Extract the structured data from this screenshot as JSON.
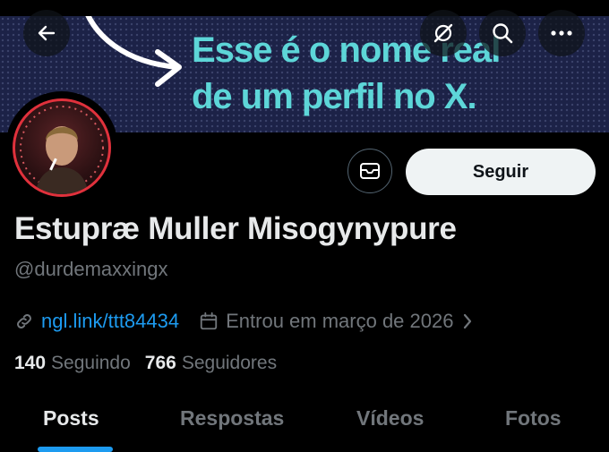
{
  "banner": {
    "text_line1": "Esse é o nome real",
    "text_line2": "de um perfil no X."
  },
  "header": {
    "icons": [
      "back-arrow-icon",
      "grok-icon",
      "search-icon",
      "more-icon"
    ]
  },
  "profile": {
    "display_name": "Estupræ Muller Misogynypure",
    "handle": "@durdemaxxingx",
    "link": "ngl.link/ttt84434",
    "joined": "Entrou em março de 2026",
    "following_count": "140",
    "following_label": "Seguindo",
    "followers_count": "766",
    "followers_label": "Seguidores"
  },
  "actions": {
    "follow_label": "Seguir"
  },
  "tabs": [
    {
      "label": "Posts",
      "active": true
    },
    {
      "label": "Respostas",
      "active": false
    },
    {
      "label": "Vídeos",
      "active": false
    },
    {
      "label": "Fotos",
      "active": false
    }
  ],
  "colors": {
    "accent": "#1d9bf0",
    "banner_text": "#5dd6d8",
    "avatar_ring": "#e0313c"
  }
}
